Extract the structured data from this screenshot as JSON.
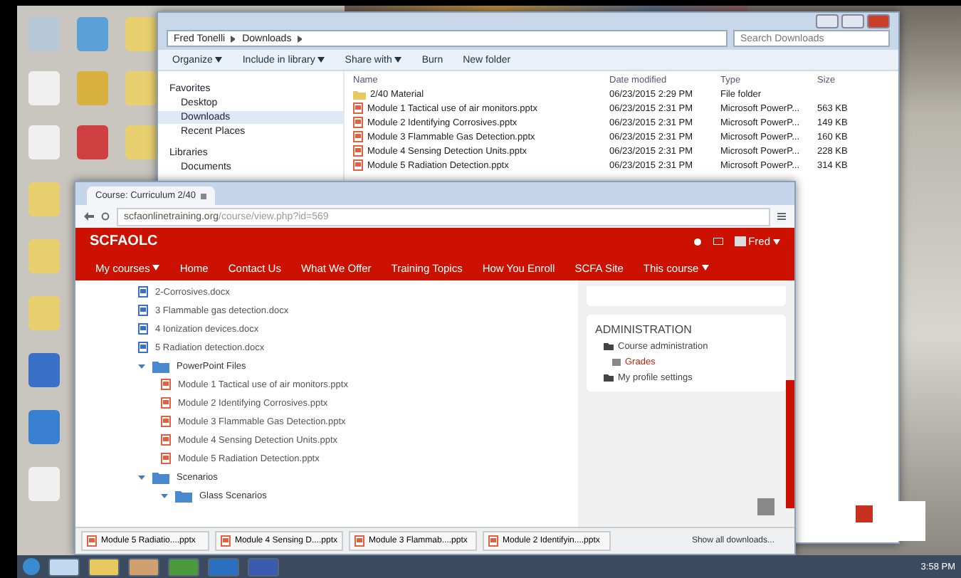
{
  "explorer": {
    "breadcrumb": [
      "Fred Tonelli",
      "Downloads"
    ],
    "search": {
      "placeholder": "Search Downloads"
    },
    "toolbar": [
      {
        "label": "Organize",
        "dropdown": true
      },
      {
        "label": "Include in library",
        "dropdown": true
      },
      {
        "label": "Share with",
        "dropdown": true
      },
      {
        "label": "Burn",
        "dropdown": false
      },
      {
        "label": "New folder",
        "dropdown": false
      }
    ],
    "nav": [
      {
        "label": "Favorites",
        "kind": "group",
        "selected": false
      },
      {
        "label": "Desktop",
        "kind": "item",
        "selected": false
      },
      {
        "label": "Downloads",
        "kind": "item",
        "selected": true
      },
      {
        "label": "Recent Places",
        "kind": "item",
        "selected": false
      },
      {
        "label": "Libraries",
        "kind": "group",
        "selected": false
      },
      {
        "label": "Documents",
        "kind": "item",
        "selected": false
      }
    ],
    "columns": [
      "Name",
      "Date modified",
      "Type",
      "Size"
    ],
    "rows": [
      {
        "kind": "folder",
        "name": "2/40 Material",
        "date": "06/23/2015 2:29 PM",
        "type": "File folder",
        "size": ""
      },
      {
        "kind": "pptx",
        "name": "Module 1 Tactical use of air monitors.pptx",
        "date": "06/23/2015 2:31 PM",
        "type": "Microsoft PowerP...",
        "size": "563 KB"
      },
      {
        "kind": "pptx",
        "name": "Module 2 Identifying Corrosives.pptx",
        "date": "06/23/2015 2:31 PM",
        "type": "Microsoft PowerP...",
        "size": "149 KB"
      },
      {
        "kind": "pptx",
        "name": "Module 3 Flammable Gas Detection.pptx",
        "date": "06/23/2015 2:31 PM",
        "type": "Microsoft PowerP...",
        "size": "160 KB"
      },
      {
        "kind": "pptx",
        "name": "Module 4 Sensing Detection Units.pptx",
        "date": "06/23/2015 2:31 PM",
        "type": "Microsoft PowerP...",
        "size": "228 KB"
      },
      {
        "kind": "pptx",
        "name": "Module 5 Radiation Detection.pptx",
        "date": "06/23/2015 2:31 PM",
        "type": "Microsoft PowerP...",
        "size": "314 KB"
      }
    ]
  },
  "browser": {
    "tab": {
      "title": "Course: Curriculum 2/40"
    },
    "url": {
      "host": "scfaonlinetraining.org",
      "path": "/course/view.php?id=569"
    },
    "brand": "SCFAOLC",
    "user": "Fred",
    "nav": [
      {
        "label": "My courses",
        "dropdown": true
      },
      {
        "label": "Home",
        "dropdown": false
      },
      {
        "label": "Contact Us",
        "dropdown": false
      },
      {
        "label": "What We Offer",
        "dropdown": false
      },
      {
        "label": "Training Topics",
        "dropdown": false
      },
      {
        "label": "How You Enroll",
        "dropdown": false
      },
      {
        "label": "SCFA Site",
        "dropdown": false
      },
      {
        "label": "This course",
        "dropdown": true
      }
    ],
    "tree": [
      {
        "label": "2-Corrosives.docx",
        "kind": "docx"
      },
      {
        "label": "3 Flammable gas detection.docx",
        "kind": "docx"
      },
      {
        "label": "4 Ionization devices.docx",
        "kind": "docx"
      },
      {
        "label": "5 Radiation detection.docx",
        "kind": "docx"
      },
      {
        "label": "PowerPoint Files",
        "kind": "folder",
        "expanded": true,
        "children": [
          {
            "label": "Module 1 Tactical use of air monitors.pptx",
            "kind": "pptx"
          },
          {
            "label": "Module 2 Identifying Corrosives.pptx",
            "kind": "pptx"
          },
          {
            "label": "Module 3 Flammable Gas Detection.pptx",
            "kind": "pptx"
          },
          {
            "label": "Module 4 Sensing Detection Units.pptx",
            "kind": "pptx"
          },
          {
            "label": "Module 5 Radiation Detection.pptx",
            "kind": "pptx"
          }
        ]
      },
      {
        "label": "Scenarios",
        "kind": "folder",
        "expanded": true,
        "children": [
          {
            "label": "Glass Scenarios",
            "kind": "folder",
            "expanded": true
          }
        ]
      }
    ],
    "admin": {
      "title": "ADMINISTRATION",
      "items": [
        {
          "label": "Course administration",
          "kind": "folder",
          "children": [
            {
              "label": "Grades",
              "kind": "link"
            }
          ]
        },
        {
          "label": "My profile settings",
          "kind": "folder"
        }
      ]
    },
    "downloads": [
      "Module 5 Radiatio....pptx",
      "Module 4 Sensing D....pptx",
      "Module 3 Flammab....pptx",
      "Module 2 Identifyin....pptx"
    ],
    "show_all": "Show all downloads..."
  },
  "taskbar": {
    "clock": "3:58 PM"
  }
}
